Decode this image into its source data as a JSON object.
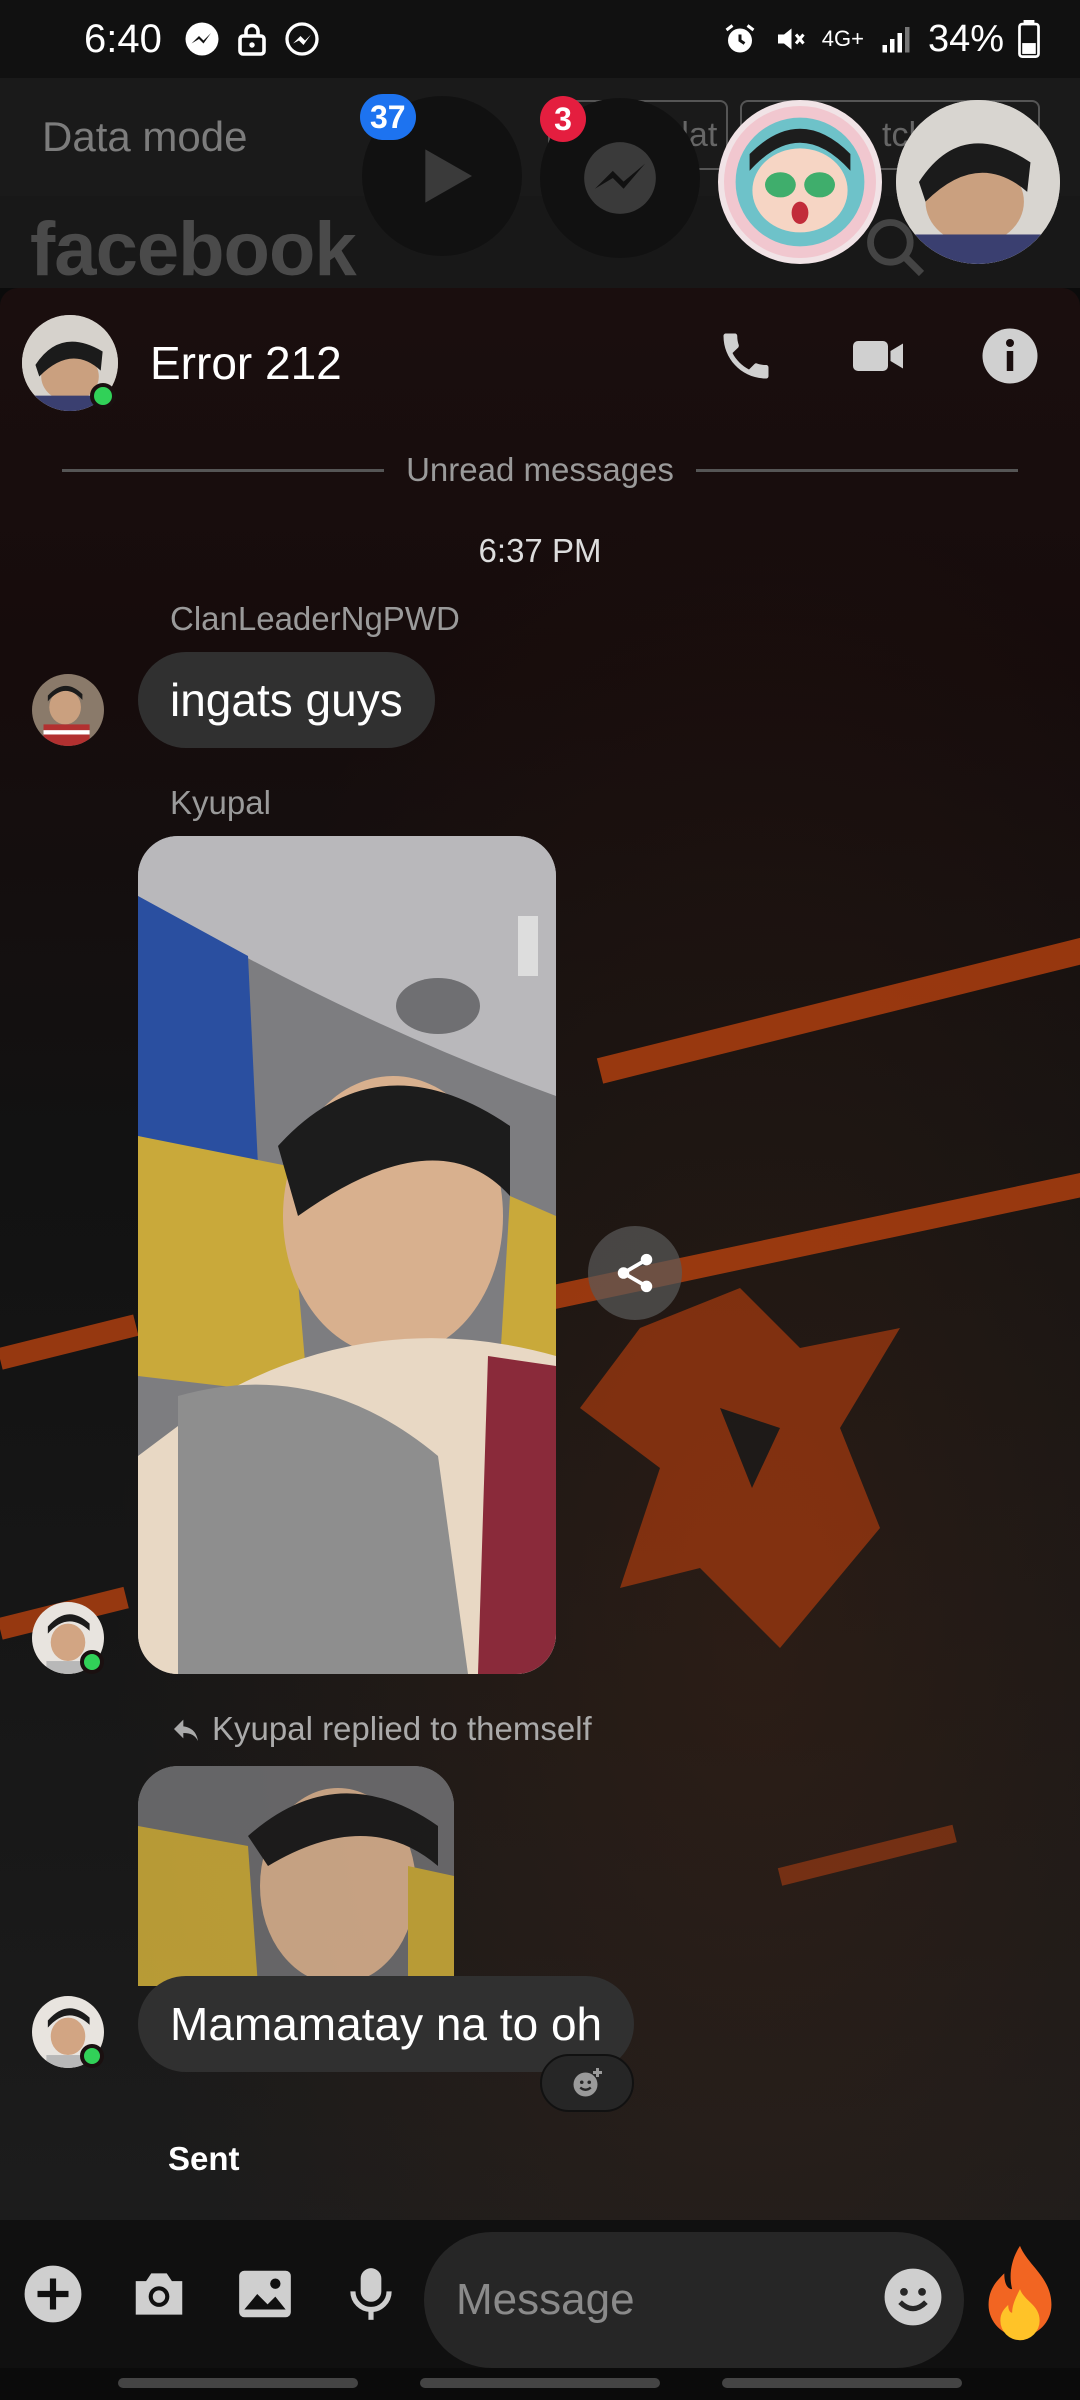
{
  "status_bar": {
    "time": "6:40",
    "network": "4G+",
    "battery": "34%",
    "icons_left": [
      "messenger-icon",
      "lock-icon",
      "messenger-icon"
    ],
    "icons_right": [
      "alarm-icon",
      "mute-icon",
      "signal-icon",
      "battery-icon"
    ]
  },
  "background_app": {
    "data_mode_label": "Data mode",
    "pill_1_text": "dat",
    "pill_2_text": "tch",
    "logo": "facebook"
  },
  "chat_heads": [
    {
      "name": "watch-videos",
      "badge": "37",
      "badge_color": "#1d73f0"
    },
    {
      "name": "messenger",
      "badge": "3",
      "badge_color": "#e41e3f"
    }
  ],
  "chat": {
    "title": "Error 212",
    "actions": [
      "phone-icon",
      "video-camera-icon",
      "info-icon"
    ],
    "unread_label": "Unread messages",
    "timestamp": "6:37 PM",
    "messages": [
      {
        "sender": "ClanLeaderNgPWD",
        "text": "ingats guys"
      },
      {
        "sender": "Kyupal",
        "type": "photo"
      },
      {
        "reply_label": "Kyupal replied to themself",
        "text": "Mamamatay na to oh"
      }
    ],
    "sent_label": "Sent"
  },
  "composer": {
    "placeholder": "Message",
    "buttons": [
      "plus-icon",
      "camera-icon",
      "gallery-icon",
      "microphone-icon"
    ],
    "emoji": "emoji-icon",
    "quick_reaction": "fire-icon"
  },
  "colors": {
    "accent_orange": "#c2440f",
    "bubble": "#303030",
    "online": "#31d158"
  }
}
